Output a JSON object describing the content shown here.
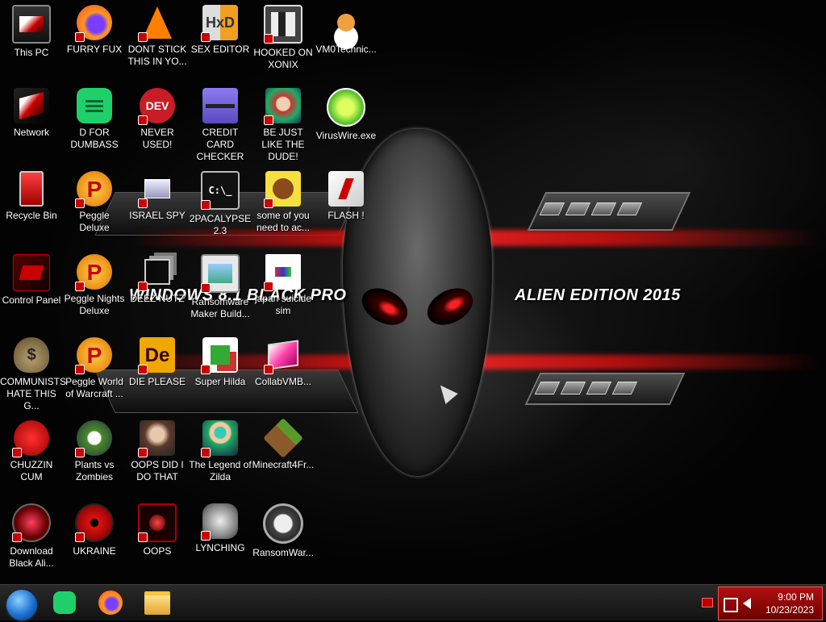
{
  "wallpaper": {
    "title_left": "WINDOWS 8.1 BLACK PRO",
    "title_right": "ALIEN EDITION 2015"
  },
  "icons": [
    {
      "label": "This PC",
      "icon": "monitor-icon"
    },
    {
      "label": "FURRY FUX",
      "icon": "firefox-icon"
    },
    {
      "label": "DONT STICK THIS IN YO...",
      "icon": "vlc-cone-icon"
    },
    {
      "label": "SEX EDITOR",
      "icon": "hex-editor-icon"
    },
    {
      "label": "HOOKED ON XONIX",
      "icon": "xonix-icon"
    },
    {
      "label": "VM0Technic...",
      "icon": "technician-icon"
    },
    {
      "label": "Network",
      "icon": "network-icon"
    },
    {
      "label": "D FOR DUMBASS",
      "icon": "chat-icon"
    },
    {
      "label": "NEVER USED!",
      "icon": "dev-cpp-icon"
    },
    {
      "label": "CREDIT CARD CHECKER",
      "icon": "credit-card-icon"
    },
    {
      "label": "BE JUST LIKE THE DUDE!",
      "icon": "elf-icon"
    },
    {
      "label": "VirusWire.exe",
      "icon": "limewire-icon"
    },
    {
      "label": "Recycle Bin",
      "icon": "recycle-bin-icon"
    },
    {
      "label": "Peggle Deluxe",
      "icon": "peggle-icon"
    },
    {
      "label": "ISRAEL SPY",
      "icon": "spy-icon"
    },
    {
      "label": "2PACALYPSE 2.3",
      "icon": "terminal-icon"
    },
    {
      "label": "some of you need to ac...",
      "icon": "beaver-icon"
    },
    {
      "label": "FLASH !",
      "icon": "flash-icon"
    },
    {
      "label": "Control Panel",
      "icon": "control-panel-icon"
    },
    {
      "label": "Peggle Nights Deluxe",
      "icon": "peggle-icon"
    },
    {
      "label": "DEEZ NUTZ",
      "icon": "stack-icon"
    },
    {
      "label": "Ransomware Maker Build...",
      "icon": "window-icon"
    },
    {
      "label": "japan suicide sim",
      "icon": "document-icon"
    },
    {
      "label": "COMMUNISTS HATE THIS G...",
      "icon": "money-bag-icon"
    },
    {
      "label": "Peggle World of Warcraft ...",
      "icon": "peggle-icon"
    },
    {
      "label": "DIE PLEASE",
      "icon": "director-icon"
    },
    {
      "label": "Super Hilda",
      "icon": "pixel-game-icon"
    },
    {
      "label": "CollabVMB...",
      "icon": "pink-window-icon"
    },
    {
      "label": "CHUZZIN CUM",
      "icon": "chuzzle-icon"
    },
    {
      "label": "Plants vs Zombies",
      "icon": "flower-icon"
    },
    {
      "label": "OOPS DID I DO THAT",
      "icon": "portrait-icon"
    },
    {
      "label": "The Legend of Zilda",
      "icon": "hero-icon"
    },
    {
      "label": "Minecraft4Fr...",
      "icon": "grass-block-icon"
    },
    {
      "label": "Download Black Ali...",
      "icon": "alien-disc-icon"
    },
    {
      "label": "UKRAINE",
      "icon": "radiation-icon"
    },
    {
      "label": "OOPS",
      "icon": "red-monitor-icon"
    },
    {
      "label": "LYNCHING",
      "icon": "emblem-icon"
    },
    {
      "label": "RansomWar...",
      "icon": "skull-icon"
    }
  ],
  "taskbar": {
    "start": "start-orb-icon",
    "pinned": [
      "chat-icon",
      "firefox-icon",
      "folder-icon"
    ]
  },
  "clock": {
    "time": "9:00 PM",
    "date": "10/23/2023"
  }
}
